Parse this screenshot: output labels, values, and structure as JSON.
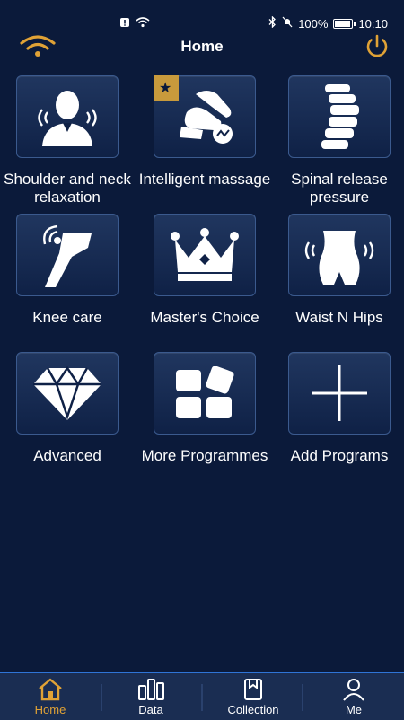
{
  "status_bar": {
    "battery": "100%",
    "time": "10:10"
  },
  "header": {
    "title": "Home"
  },
  "tiles": [
    {
      "label": "Shoulder and neck relaxation",
      "icon": "shoulder-neck-icon"
    },
    {
      "label": "Intelligent massage",
      "icon": "massage-chair-icon"
    },
    {
      "label": "Spinal release pressure",
      "icon": "spine-icon"
    },
    {
      "label": "Knee care",
      "icon": "knee-icon"
    },
    {
      "label": "Master's Choice",
      "icon": "crown-icon"
    },
    {
      "label": "Waist N Hips",
      "icon": "waist-hips-icon"
    },
    {
      "label": "Advanced",
      "icon": "diamond-icon"
    },
    {
      "label": "More Programmes",
      "icon": "more-programs-icon"
    },
    {
      "label": "Add Programs",
      "icon": "plus-icon"
    }
  ],
  "bottom_nav": [
    {
      "label": "Home",
      "icon": "home-icon",
      "active": true
    },
    {
      "label": "Data",
      "icon": "bar-chart-icon",
      "active": false
    },
    {
      "label": "Collection",
      "icon": "collection-icon",
      "active": false
    },
    {
      "label": "Me",
      "icon": "person-icon",
      "active": false
    }
  ],
  "colors": {
    "accent": "#e0a236",
    "background": "#0b1a3a",
    "tile": "#172c54"
  }
}
